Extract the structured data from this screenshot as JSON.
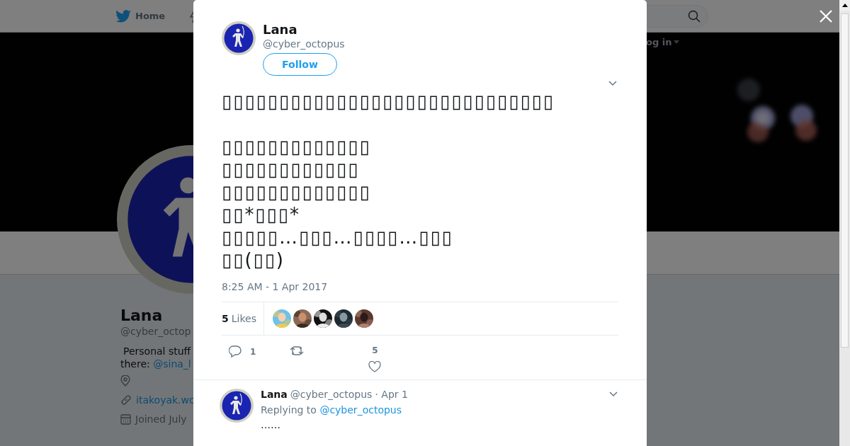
{
  "nav": {
    "home": "Home",
    "login": "og in"
  },
  "profile": {
    "name": "Lana",
    "handle": "@cyber_octop",
    "bio": "Personal stuff",
    "bio_prefix": "there:",
    "bio_link": "@sina_l",
    "website": "itakoyak.wo",
    "joined": "Joined July"
  },
  "tweet": {
    "name": "Lana",
    "handle": "@cyber_octopus",
    "follow": "Follow",
    "paragraphs": [
      [
        "▯▯▯▯▯▯▯▯▯▯▯▯▯▯▯▯▯▯▯▯▯▯▯▯▯▯▯▯▯"
      ],
      [
        "▯▯▯▯▯▯▯▯▯▯▯▯▯",
        "▯▯▯▯▯▯▯▯▯▯▯▯",
        "▯▯▯▯▯▯▯▯▯▯▯▯▯",
        "▯▯*▯▯▯*",
        "▯▯▯▯▯…▯▯▯…▯▯▯▯…▯▯▯",
        "▯▯(▯▯)"
      ]
    ],
    "time": "8:25 AM - 1 Apr 2017",
    "likes_count": "5",
    "likes_label": "Likes",
    "likers": [
      {
        "kind": "picture"
      },
      {
        "kind": "picture"
      },
      {
        "kind": "picture"
      },
      {
        "kind": "picture"
      },
      {
        "kind": "picture"
      }
    ],
    "reply_count": "1",
    "like_count": "5"
  },
  "reply": {
    "name": "Lana",
    "handle": "@cyber_octopus",
    "date": "· Apr 1",
    "replying_label": "Replying to",
    "replying_to": "@cyber_octopus",
    "text": "……"
  }
}
